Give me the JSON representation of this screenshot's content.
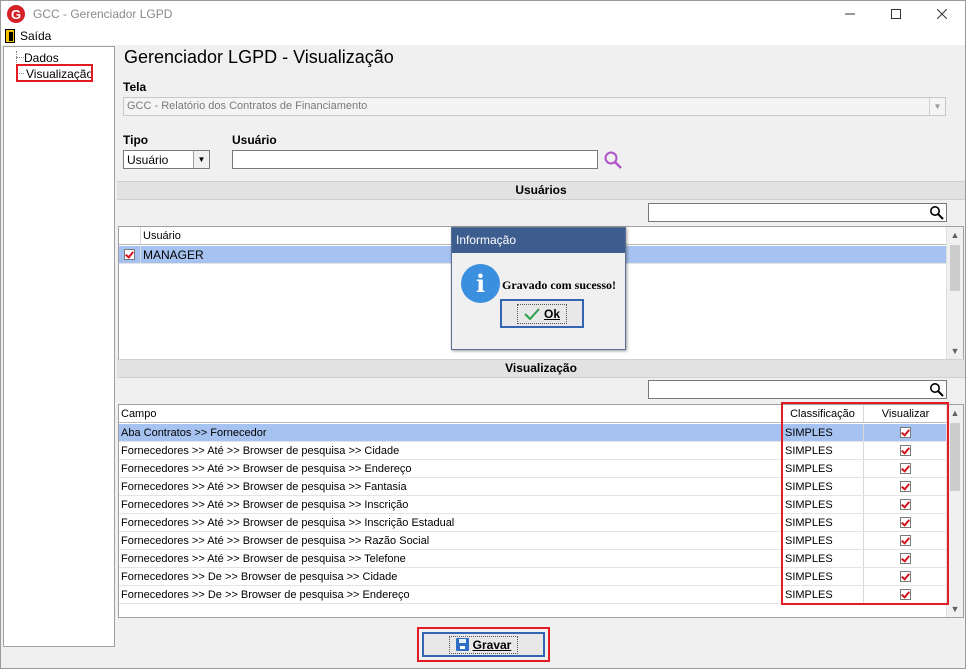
{
  "window": {
    "title": "GCC - Gerenciador LGPD",
    "logo_letter": "G",
    "controls": [
      "minimize-icon",
      "maximize-icon",
      "close-icon"
    ]
  },
  "menu": {
    "exit_label": "Saída"
  },
  "tree": {
    "items": [
      "Dados",
      "Visualização"
    ]
  },
  "page": {
    "title": "Gerenciador LGPD - Visualização"
  },
  "tela": {
    "label": "Tela",
    "value": "GCC - Relatório dos Contratos de Financiamento"
  },
  "tipo": {
    "label": "Tipo",
    "value": "Usuário"
  },
  "usuario": {
    "label": "Usuário",
    "value": "",
    "search_icon": "magnifier-icon"
  },
  "usuarios_section": {
    "header": "Usuários",
    "filter_value": "",
    "column": "Usuário",
    "rows": [
      {
        "checked": true,
        "name": "MANAGER"
      }
    ]
  },
  "visualizacao_section": {
    "header": "Visualização",
    "filter_value": "",
    "columns": {
      "campo": "Campo",
      "classificacao": "Classificação",
      "visualizar": "Visualizar"
    },
    "rows": [
      {
        "campo": "Aba Contratos >> Fornecedor",
        "classificacao": "SIMPLES",
        "visualizar": true
      },
      {
        "campo": "Fornecedores >> Até >> Browser de pesquisa >> Cidade",
        "classificacao": "SIMPLES",
        "visualizar": true
      },
      {
        "campo": "Fornecedores >> Até >> Browser de pesquisa >> Endereço",
        "classificacao": "SIMPLES",
        "visualizar": true
      },
      {
        "campo": "Fornecedores >> Até >> Browser de pesquisa >> Fantasia",
        "classificacao": "SIMPLES",
        "visualizar": true
      },
      {
        "campo": "Fornecedores >> Até >> Browser de pesquisa >> Inscrição",
        "classificacao": "SIMPLES",
        "visualizar": true
      },
      {
        "campo": "Fornecedores >> Até >> Browser de pesquisa >> Inscrição Estadual",
        "classificacao": "SIMPLES",
        "visualizar": true
      },
      {
        "campo": "Fornecedores >> Até >> Browser de pesquisa >> Razão Social",
        "classificacao": "SIMPLES",
        "visualizar": true
      },
      {
        "campo": "Fornecedores >> Até >> Browser de pesquisa >> Telefone",
        "classificacao": "SIMPLES",
        "visualizar": true
      },
      {
        "campo": "Fornecedores >> De >> Browser de pesquisa >> Cidade",
        "classificacao": "SIMPLES",
        "visualizar": true
      },
      {
        "campo": "Fornecedores >> De >> Browser de pesquisa >> Endereço",
        "classificacao": "SIMPLES",
        "visualizar": true
      }
    ]
  },
  "dialog": {
    "title": "Informação",
    "icon": "info-icon",
    "message": "Gravado com sucesso!",
    "ok_label": "Ok"
  },
  "save_button": {
    "label": "Gravar",
    "icon": "floppy-disk-icon"
  },
  "colors": {
    "selection": "#a6c2f0",
    "dialog_title": "#3d5d8f",
    "highlight_box": "#e31b23",
    "check": "#d4151e"
  }
}
